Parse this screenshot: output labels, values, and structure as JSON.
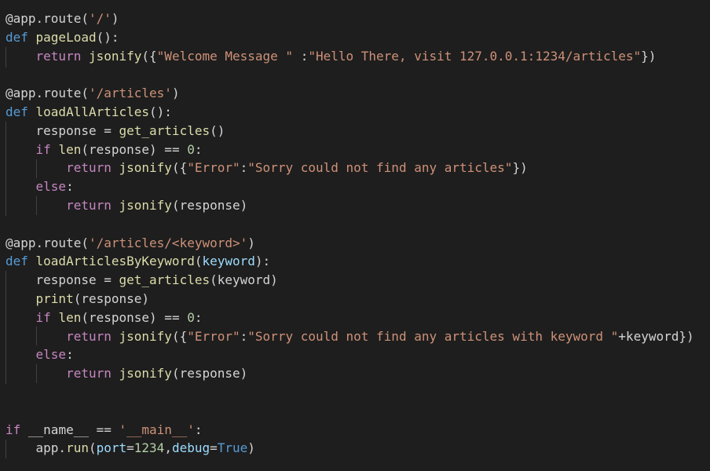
{
  "editor": {
    "language": "python",
    "theme": "dark",
    "lines": [
      [
        {
          "t": "@app.route(",
          "c": "plain"
        },
        {
          "t": "'/'",
          "c": "str"
        },
        {
          "t": ")",
          "c": "plain"
        }
      ],
      [
        {
          "t": "def ",
          "c": "kw"
        },
        {
          "t": "pageLoad",
          "c": "fn"
        },
        {
          "t": "():",
          "c": "plain"
        }
      ],
      [
        {
          "t": "    ",
          "c": "plain"
        },
        {
          "t": "return ",
          "c": "ctrl"
        },
        {
          "t": "jsonify",
          "c": "fn"
        },
        {
          "t": "({",
          "c": "plain"
        },
        {
          "t": "\"Welcome Message \"",
          "c": "str"
        },
        {
          "t": " :",
          "c": "plain"
        },
        {
          "t": "\"Hello There, visit 127.0.0.1:1234/articles\"",
          "c": "str"
        },
        {
          "t": "})",
          "c": "plain"
        }
      ],
      [],
      [
        {
          "t": "@app.route(",
          "c": "plain"
        },
        {
          "t": "'/articles'",
          "c": "str"
        },
        {
          "t": ")",
          "c": "plain"
        }
      ],
      [
        {
          "t": "def ",
          "c": "kw"
        },
        {
          "t": "loadAllArticles",
          "c": "fn"
        },
        {
          "t": "():",
          "c": "plain"
        }
      ],
      [
        {
          "t": "    response = ",
          "c": "plain"
        },
        {
          "t": "get_articles",
          "c": "fn"
        },
        {
          "t": "()",
          "c": "plain"
        }
      ],
      [
        {
          "t": "    ",
          "c": "plain"
        },
        {
          "t": "if ",
          "c": "ctrl"
        },
        {
          "t": "len",
          "c": "builtin"
        },
        {
          "t": "(response) == ",
          "c": "plain"
        },
        {
          "t": "0",
          "c": "num"
        },
        {
          "t": ":",
          "c": "plain"
        }
      ],
      [
        {
          "t": "        ",
          "c": "plain"
        },
        {
          "t": "return ",
          "c": "ctrl"
        },
        {
          "t": "jsonify",
          "c": "fn"
        },
        {
          "t": "({",
          "c": "plain"
        },
        {
          "t": "\"Error\"",
          "c": "str"
        },
        {
          "t": ":",
          "c": "plain"
        },
        {
          "t": "\"Sorry could not find any articles\"",
          "c": "str"
        },
        {
          "t": "})",
          "c": "plain"
        }
      ],
      [
        {
          "t": "    ",
          "c": "plain"
        },
        {
          "t": "else",
          "c": "ctrl"
        },
        {
          "t": ":",
          "c": "plain"
        }
      ],
      [
        {
          "t": "        ",
          "c": "plain"
        },
        {
          "t": "return ",
          "c": "ctrl"
        },
        {
          "t": "jsonify",
          "c": "fn"
        },
        {
          "t": "(response)",
          "c": "plain"
        }
      ],
      [],
      [
        {
          "t": "@app.route(",
          "c": "plain"
        },
        {
          "t": "'/articles/<keyword>'",
          "c": "str"
        },
        {
          "t": ")",
          "c": "plain"
        }
      ],
      [
        {
          "t": "def ",
          "c": "kw"
        },
        {
          "t": "loadArticlesByKeyword",
          "c": "fn"
        },
        {
          "t": "(",
          "c": "plain"
        },
        {
          "t": "keyword",
          "c": "param"
        },
        {
          "t": "):",
          "c": "plain"
        }
      ],
      [
        {
          "t": "    response = ",
          "c": "plain"
        },
        {
          "t": "get_articles",
          "c": "fn"
        },
        {
          "t": "(keyword)",
          "c": "plain"
        }
      ],
      [
        {
          "t": "    ",
          "c": "plain"
        },
        {
          "t": "print",
          "c": "builtin"
        },
        {
          "t": "(response)",
          "c": "plain"
        }
      ],
      [
        {
          "t": "    ",
          "c": "plain"
        },
        {
          "t": "if ",
          "c": "ctrl"
        },
        {
          "t": "len",
          "c": "builtin"
        },
        {
          "t": "(response) == ",
          "c": "plain"
        },
        {
          "t": "0",
          "c": "num"
        },
        {
          "t": ":",
          "c": "plain"
        }
      ],
      [
        {
          "t": "        ",
          "c": "plain"
        },
        {
          "t": "return ",
          "c": "ctrl"
        },
        {
          "t": "jsonify",
          "c": "fn"
        },
        {
          "t": "({",
          "c": "plain"
        },
        {
          "t": "\"Error\"",
          "c": "str"
        },
        {
          "t": ":",
          "c": "plain"
        },
        {
          "t": "\"Sorry could not find any articles with keyword \"",
          "c": "str"
        },
        {
          "t": "+keyword})",
          "c": "plain"
        }
      ],
      [
        {
          "t": "    ",
          "c": "plain"
        },
        {
          "t": "else",
          "c": "ctrl"
        },
        {
          "t": ":",
          "c": "plain"
        }
      ],
      [
        {
          "t": "        ",
          "c": "plain"
        },
        {
          "t": "return ",
          "c": "ctrl"
        },
        {
          "t": "jsonify",
          "c": "fn"
        },
        {
          "t": "(response)",
          "c": "plain"
        }
      ],
      [],
      [],
      [
        {
          "t": "if ",
          "c": "ctrl"
        },
        {
          "t": "__name__ == ",
          "c": "plain"
        },
        {
          "t": "'__main__'",
          "c": "str"
        },
        {
          "t": ":",
          "c": "plain"
        }
      ],
      [
        {
          "t": "    app.",
          "c": "plain"
        },
        {
          "t": "run",
          "c": "fn"
        },
        {
          "t": "(",
          "c": "plain"
        },
        {
          "t": "port",
          "c": "param"
        },
        {
          "t": "=",
          "c": "plain"
        },
        {
          "t": "1234",
          "c": "num"
        },
        {
          "t": ",",
          "c": "plain"
        },
        {
          "t": "debug",
          "c": "param"
        },
        {
          "t": "=",
          "c": "plain"
        },
        {
          "t": "True",
          "c": "kw"
        },
        {
          "t": ")",
          "c": "plain"
        }
      ]
    ]
  }
}
